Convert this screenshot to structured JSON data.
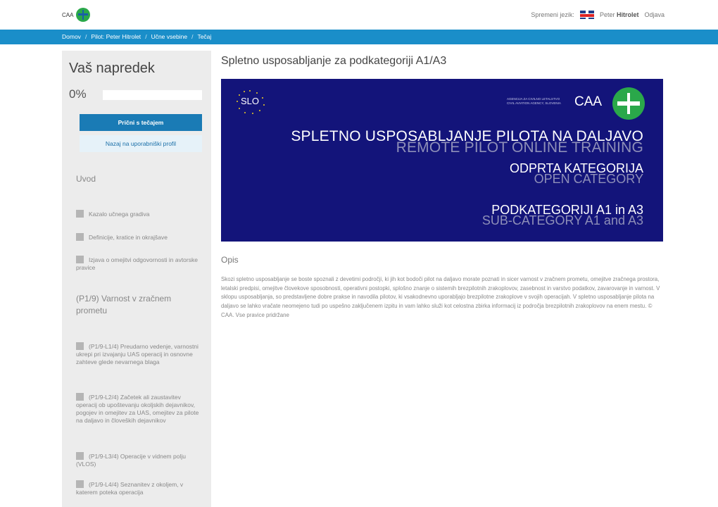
{
  "header": {
    "logo_text": "CAA",
    "language_label": "Spremeni jezik:",
    "user_first": "Peter",
    "user_last": "Hitrolet",
    "logout": "Odjava"
  },
  "breadcrumb": [
    {
      "label": "Domov"
    },
    {
      "label": "Pilot: Peter Hitrolet"
    },
    {
      "label": "Učne vsebine"
    },
    {
      "label": "Tečaj"
    }
  ],
  "breadcrumb_sep": "/",
  "sidebar": {
    "title": "Vaš napredek",
    "progress_text": "0%",
    "progress_value": 0,
    "start_button": "Prični s tečajem",
    "back_button": "Nazaj na uporabniški profil",
    "section_intro": "Uvod",
    "intro_items": [
      "Kazalo učnega gradiva",
      "Definicije, kratice in okrajšave",
      "Izjava o omejitvi odgovornosti in avtorske pravice"
    ],
    "section_p1": "(P1/9) Varnost v zračnem prometu",
    "p1_items": [
      "(P1/9-L1/4) Preudarno vedenje, varnostni ukrepi pri izvajanju UAS operacij in osnovne zahteve glede nevarnega blaga",
      "(P1/9-L2/4) Začetek ali zaustavitev operacij ob upoštevanju okoljskih dejavnikov, pogojev in omejitev za UAS, omejitev za pilote na daljavo in človeških dejavnikov",
      "(P1/9-L3/4) Operacije v vidnem polju (VLOS)",
      "(P1/9-L4/4) Seznanitev z okoljem, v katerem poteka operacija"
    ]
  },
  "main": {
    "title": "Spletno usposabljanje za podkategoriji A1/A3",
    "banner": {
      "slo": "SLO",
      "agency_sl": "AGENCIJA ZA CIVILNO LETALSTVO",
      "agency_en": "CIVIL AVIATION AGENCY, SLOVENIA",
      "caa": "CAA",
      "line1": "SPLETNO USPOSABLJANJE PILOTA NA DALJAVO",
      "line2": "REMOTE PILOT ONLINE TRAINING",
      "line3": "ODPRTA KATEGORIJA",
      "line4": "OPEN CATEGORY",
      "line5": "PODKATEGORIJI A1 in A3",
      "line6": "SUB-CATEGORY A1 and A3"
    },
    "description_heading": "Opis",
    "description": "Skozi spletno usposabljanje se boste spoznali z devetimi področji, ki jih kot bodoči pilot na daljavo morate poznati in sicer varnost v zračnem prometu, omejitve zračnega prostora, letalski predpisi, omejitve človekove sposobnosti, operativni postopki, splošno znanje o sistemih brezpilotnih zrakoplovov, zasebnost in varstvo podatkov, zavarovanje in varnost. V sklopu usposabljanja, so predstavljene dobre prakse in navodila pilotov, ki vsakodnevno uporabljajo brezpilotne zrakoplove v svojih operacijah. V spletno usposabljanje pilota na daljavo se lahko vračate neomejeno tudi po uspešno zaključenem izpitu in vam lahko služi kot celostna zbirka informacij iz področja brezpilotnih zrakoplovov na enem mestu. © CAA. Vse pravice pridržane"
  },
  "colors": {
    "accent": "#1a8ec9",
    "button": "#1a7bb5",
    "banner": "#13147a",
    "logo_green": "#2aa84a"
  }
}
